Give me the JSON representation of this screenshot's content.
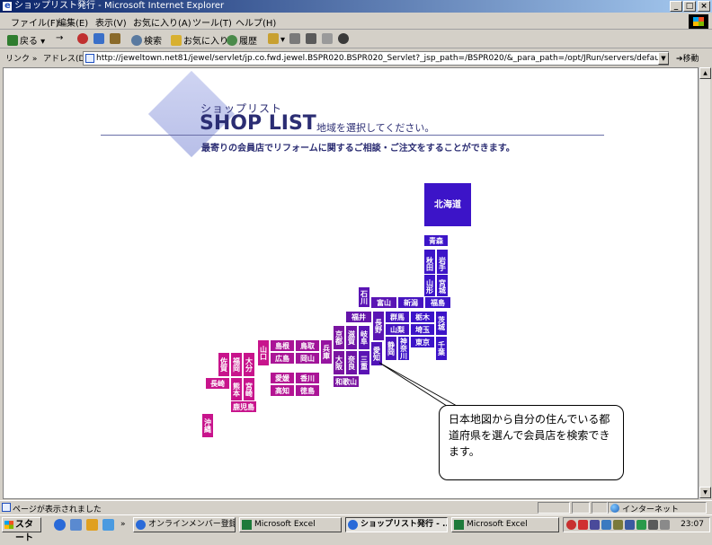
{
  "window": {
    "title": "ショップリスト発行 - Microsoft Internet Explorer",
    "controls": {
      "minimize": "_",
      "maximize": "□",
      "close": "×"
    }
  },
  "menu": [
    "ファイル(F)",
    "編集(E)",
    "表示(V)",
    "お気に入り(A)",
    "ツール(T)",
    "ヘルプ(H)"
  ],
  "toolbar": {
    "back": "戻る",
    "forward": "→",
    "search": "検索",
    "favorites": "お気に入り",
    "history": "履歴"
  },
  "address": {
    "links_label": "リンク »",
    "label": "アドレス(D)",
    "url": "http://jeweltown.net81/jewel/servlet/jp.co.fwd.jewel.BSPR020.BSPR020_Servlet?_jsp_path=/BSPR020/&_para_path=/opt/JRun/servers/default/jewel/",
    "go": "移動"
  },
  "page": {
    "kana_title": "ショップリスト",
    "title": "SHOP LIST",
    "subtitle": "地域を選択してください。",
    "description": "最寄りの会員店でリフォームに関するご相談・ご注文をすることができます。"
  },
  "prefectures": [
    {
      "id": "hokkaido",
      "label": "北海道",
      "color": "#3c14c8"
    },
    {
      "id": "aomori",
      "label": "青森",
      "color": "#3c14c8"
    },
    {
      "id": "akita",
      "label": "秋田",
      "color": "#3c14c8"
    },
    {
      "id": "iwate",
      "label": "岩手",
      "color": "#3c14c8"
    },
    {
      "id": "yamagata",
      "label": "山形",
      "color": "#3c14c8"
    },
    {
      "id": "miyagi",
      "label": "宮城",
      "color": "#3c14c8"
    },
    {
      "id": "ishikawa",
      "label": "石川",
      "color": "#5a14b4"
    },
    {
      "id": "toyama",
      "label": "富山",
      "color": "#5a14b4"
    },
    {
      "id": "niigata",
      "label": "新潟",
      "color": "#4614c0"
    },
    {
      "id": "fukushima",
      "label": "福島",
      "color": "#3c14c8"
    },
    {
      "id": "fukui",
      "label": "福井",
      "color": "#6414aa"
    },
    {
      "id": "nagano",
      "label": "長野",
      "color": "#5a14b4"
    },
    {
      "id": "gunma",
      "label": "群馬",
      "color": "#4614c0"
    },
    {
      "id": "tochigi",
      "label": "栃木",
      "color": "#3c14c8"
    },
    {
      "id": "ibaraki",
      "label": "茨城",
      "color": "#3c14c8"
    },
    {
      "id": "yamanashi",
      "label": "山梨",
      "color": "#4614c0"
    },
    {
      "id": "saitama",
      "label": "埼玉",
      "color": "#3c14c8"
    },
    {
      "id": "kyoto",
      "label": "京都",
      "color": "#7a14a0"
    },
    {
      "id": "shiga",
      "label": "滋賀",
      "color": "#6e14a6"
    },
    {
      "id": "gifu",
      "label": "岐阜",
      "color": "#5a14b4"
    },
    {
      "id": "shizuoka",
      "label": "静岡",
      "color": "#4a14bc"
    },
    {
      "id": "kanagawa",
      "label": "神奈川",
      "color": "#3c14c8"
    },
    {
      "id": "tokyo",
      "label": "東京",
      "color": "#3c14c8"
    },
    {
      "id": "chiba",
      "label": "千葉",
      "color": "#3c14c8"
    },
    {
      "id": "hyogo",
      "label": "兵庫",
      "color": "#9614a0"
    },
    {
      "id": "osaka",
      "label": "大阪",
      "color": "#7a14a0"
    },
    {
      "id": "nara",
      "label": "奈良",
      "color": "#6e14a6"
    },
    {
      "id": "mie",
      "label": "三重",
      "color": "#5a14b4"
    },
    {
      "id": "aichi",
      "label": "愛知",
      "color": "#5014b8"
    },
    {
      "id": "wakayama",
      "label": "和歌山",
      "color": "#7a14a0"
    },
    {
      "id": "yamaguchi",
      "label": "山口",
      "color": "#c8148c"
    },
    {
      "id": "shimane",
      "label": "島根",
      "color": "#aa1496"
    },
    {
      "id": "tottori",
      "label": "鳥取",
      "color": "#a01498"
    },
    {
      "id": "hiroshima",
      "label": "広島",
      "color": "#aa1496"
    },
    {
      "id": "okayama",
      "label": "岡山",
      "color": "#a01498"
    },
    {
      "id": "ehime",
      "label": "愛媛",
      "color": "#b41492"
    },
    {
      "id": "kagawa",
      "label": "香川",
      "color": "#aa1496"
    },
    {
      "id": "kochi",
      "label": "高知",
      "color": "#b41492"
    },
    {
      "id": "tokushima",
      "label": "徳島",
      "color": "#aa1496"
    },
    {
      "id": "saga",
      "label": "佐賀",
      "color": "#c8148c"
    },
    {
      "id": "fukuoka",
      "label": "福岡",
      "color": "#c8148c"
    },
    {
      "id": "oita",
      "label": "大分",
      "color": "#c8148c"
    },
    {
      "id": "nagasaki",
      "label": "長崎",
      "color": "#c8148c"
    },
    {
      "id": "kumamoto",
      "label": "熊本",
      "color": "#c8148c"
    },
    {
      "id": "miyazaki",
      "label": "宮崎",
      "color": "#c8148c"
    },
    {
      "id": "kagoshima",
      "label": "鹿児島",
      "color": "#c8148c"
    },
    {
      "id": "okinawa",
      "label": "沖縄",
      "color": "#c8148c"
    }
  ],
  "callout": "日本地図から自分の住んでいる都道府県を選んで会員店を検索できます。",
  "status": {
    "text": "ページが表示されました",
    "zone": "インターネット"
  },
  "taskbar": {
    "start": "スタート",
    "tasks": [
      "オンラインメンバー登録",
      "Microsoft Excel",
      "ショップリスト発行 - ...",
      "Microsoft Excel"
    ],
    "clock": "23:07"
  }
}
